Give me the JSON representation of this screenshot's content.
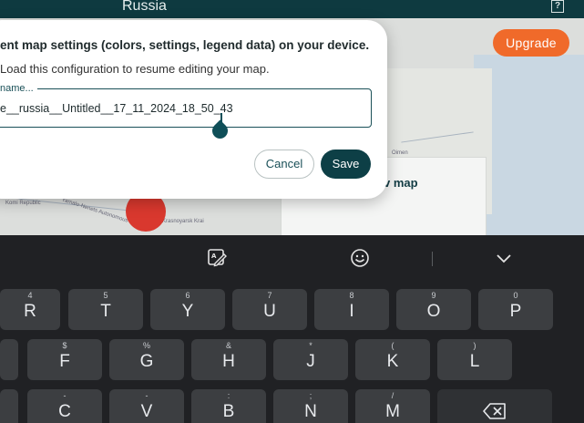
{
  "app": {
    "title": "Russia",
    "help_glyph": "?",
    "upgrade_label": "Upgrade",
    "view_map_label": "v map",
    "map_labels": [
      "Komi Republic",
      "Yamalo-Nenets Autonomous",
      "Krasnoyarsk Krai",
      "Oimen"
    ]
  },
  "dialog": {
    "title": "ent map settings (colors, settings, legend data) on your device.",
    "description": "Load this configuration to resume editing your map.",
    "field_label": "name...",
    "field_value": "e__russia__Untitled__17_11_2024_18_50_43",
    "cancel_label": "Cancel",
    "save_label": "Save"
  },
  "keyboard": {
    "rows": [
      [
        {
          "main": "R",
          "hint": "4"
        },
        {
          "main": "T",
          "hint": "5"
        },
        {
          "main": "Y",
          "hint": "6"
        },
        {
          "main": "U",
          "hint": "7"
        },
        {
          "main": "I",
          "hint": "8"
        },
        {
          "main": "O",
          "hint": "9"
        },
        {
          "main": "P",
          "hint": "0"
        }
      ],
      [
        {
          "main": "",
          "hint": ""
        },
        {
          "main": "F",
          "hint": "$"
        },
        {
          "main": "G",
          "hint": "%"
        },
        {
          "main": "H",
          "hint": "&"
        },
        {
          "main": "J",
          "hint": "*"
        },
        {
          "main": "K",
          "hint": "("
        },
        {
          "main": "L",
          "hint": ")"
        }
      ],
      [
        {
          "main": "C",
          "hint": "-"
        },
        {
          "main": "V",
          "hint": "-"
        },
        {
          "main": "B",
          "hint": ":"
        },
        {
          "main": "N",
          "hint": ";"
        },
        {
          "main": "M",
          "hint": "/"
        }
      ]
    ]
  }
}
